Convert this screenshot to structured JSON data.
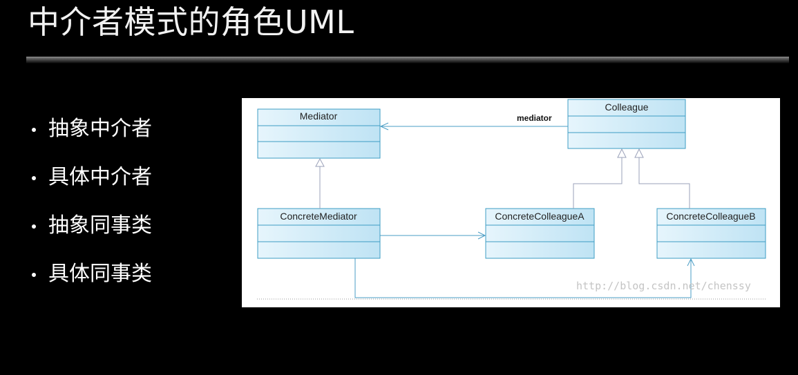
{
  "slide": {
    "title": "中介者模式的角色UML"
  },
  "roles": [
    {
      "label": "抽象中介者"
    },
    {
      "label": "具体中介者"
    },
    {
      "label": "抽象同事类"
    },
    {
      "label": "具体同事类"
    }
  ],
  "diagram": {
    "classes": {
      "mediator": "Mediator",
      "colleague": "Colleague",
      "concrete_mediator": "ConcreteMediator",
      "concrete_colleague_a": "ConcreteColleagueA",
      "concrete_colleague_b": "ConcreteColleagueB"
    },
    "association_label": "mediator",
    "watermark": "http://blog.csdn.net/chenssy"
  },
  "colors": {
    "box_fill": "#d2ecf8",
    "box_stroke": "#3d9cc3",
    "line": "#4a9cc4",
    "inherit_line": "#9aa0b8"
  }
}
